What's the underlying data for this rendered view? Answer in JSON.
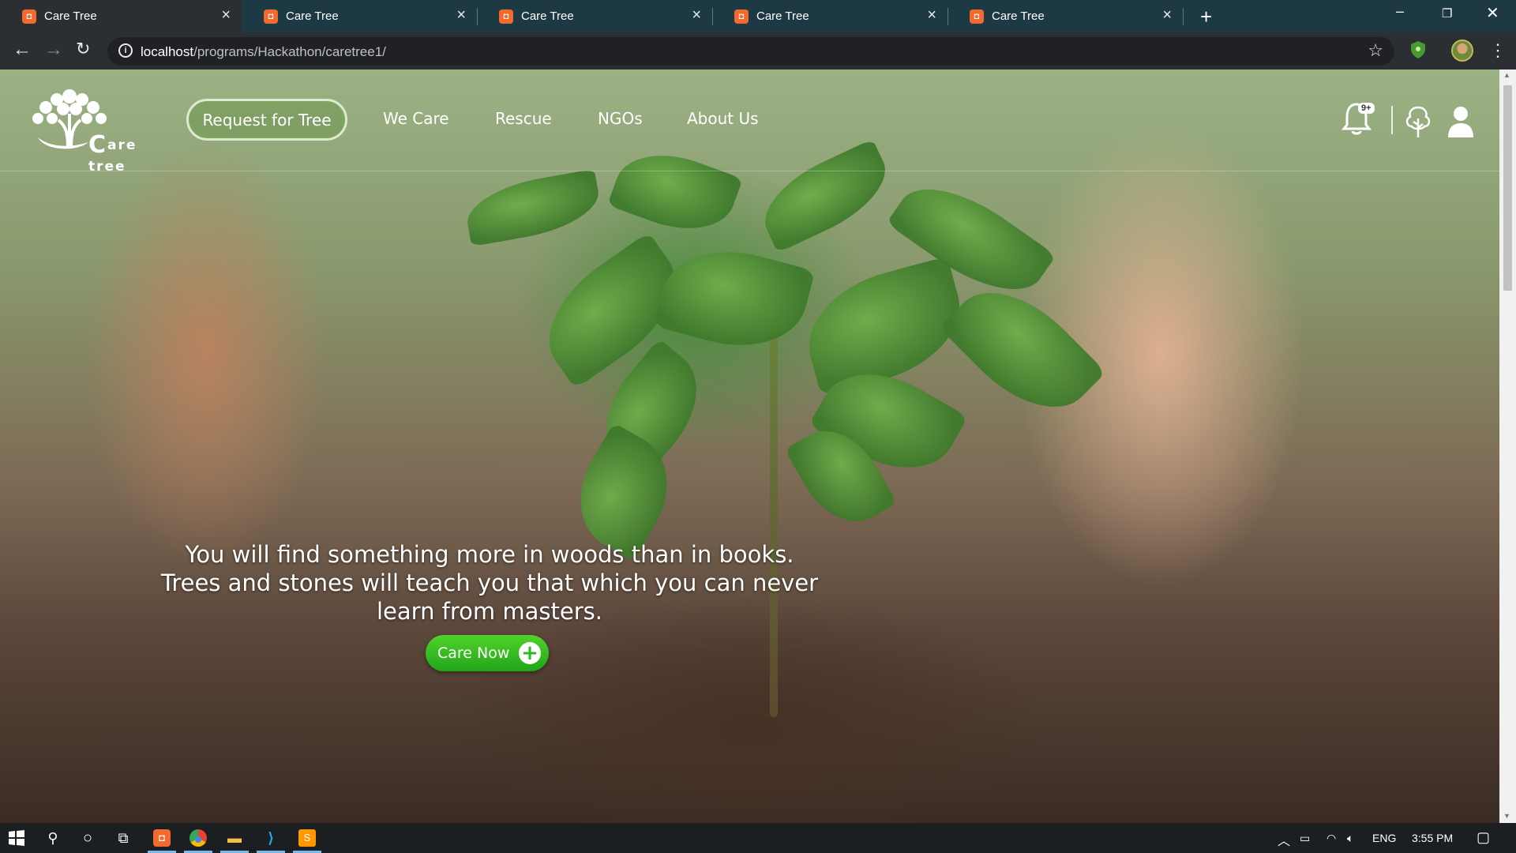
{
  "browser": {
    "tabs": [
      {
        "title": "Care Tree",
        "favicon": "care-tree-favicon"
      },
      {
        "title": "Care Tree",
        "favicon": "care-tree-favicon"
      },
      {
        "title": "Care Tree",
        "favicon": "care-tree-favicon"
      },
      {
        "title": "Care Tree",
        "favicon": "care-tree-favicon"
      },
      {
        "title": "Care Tree",
        "favicon": "care-tree-favicon"
      }
    ],
    "new_tab": "+",
    "url_host": "localhost",
    "url_path": "/programs/Hackathon/caretree1/"
  },
  "site": {
    "logo_text": "are tree",
    "logo_initial": "C",
    "request_button": "Request for Tree",
    "nav": [
      "We Care",
      "Rescue",
      "NGOs",
      "About Us"
    ],
    "notification_badge": "9+",
    "quote_lines": [
      "You will find something more in woods than in books.",
      "Trees and stones will teach you that which you can never",
      "learn from masters."
    ],
    "cta_label": "Care Now",
    "cta_icon": "plus-circle-icon",
    "accent_color": "#2eb722"
  },
  "taskbar": {
    "language": "ENG",
    "time": "3:55 PM"
  }
}
